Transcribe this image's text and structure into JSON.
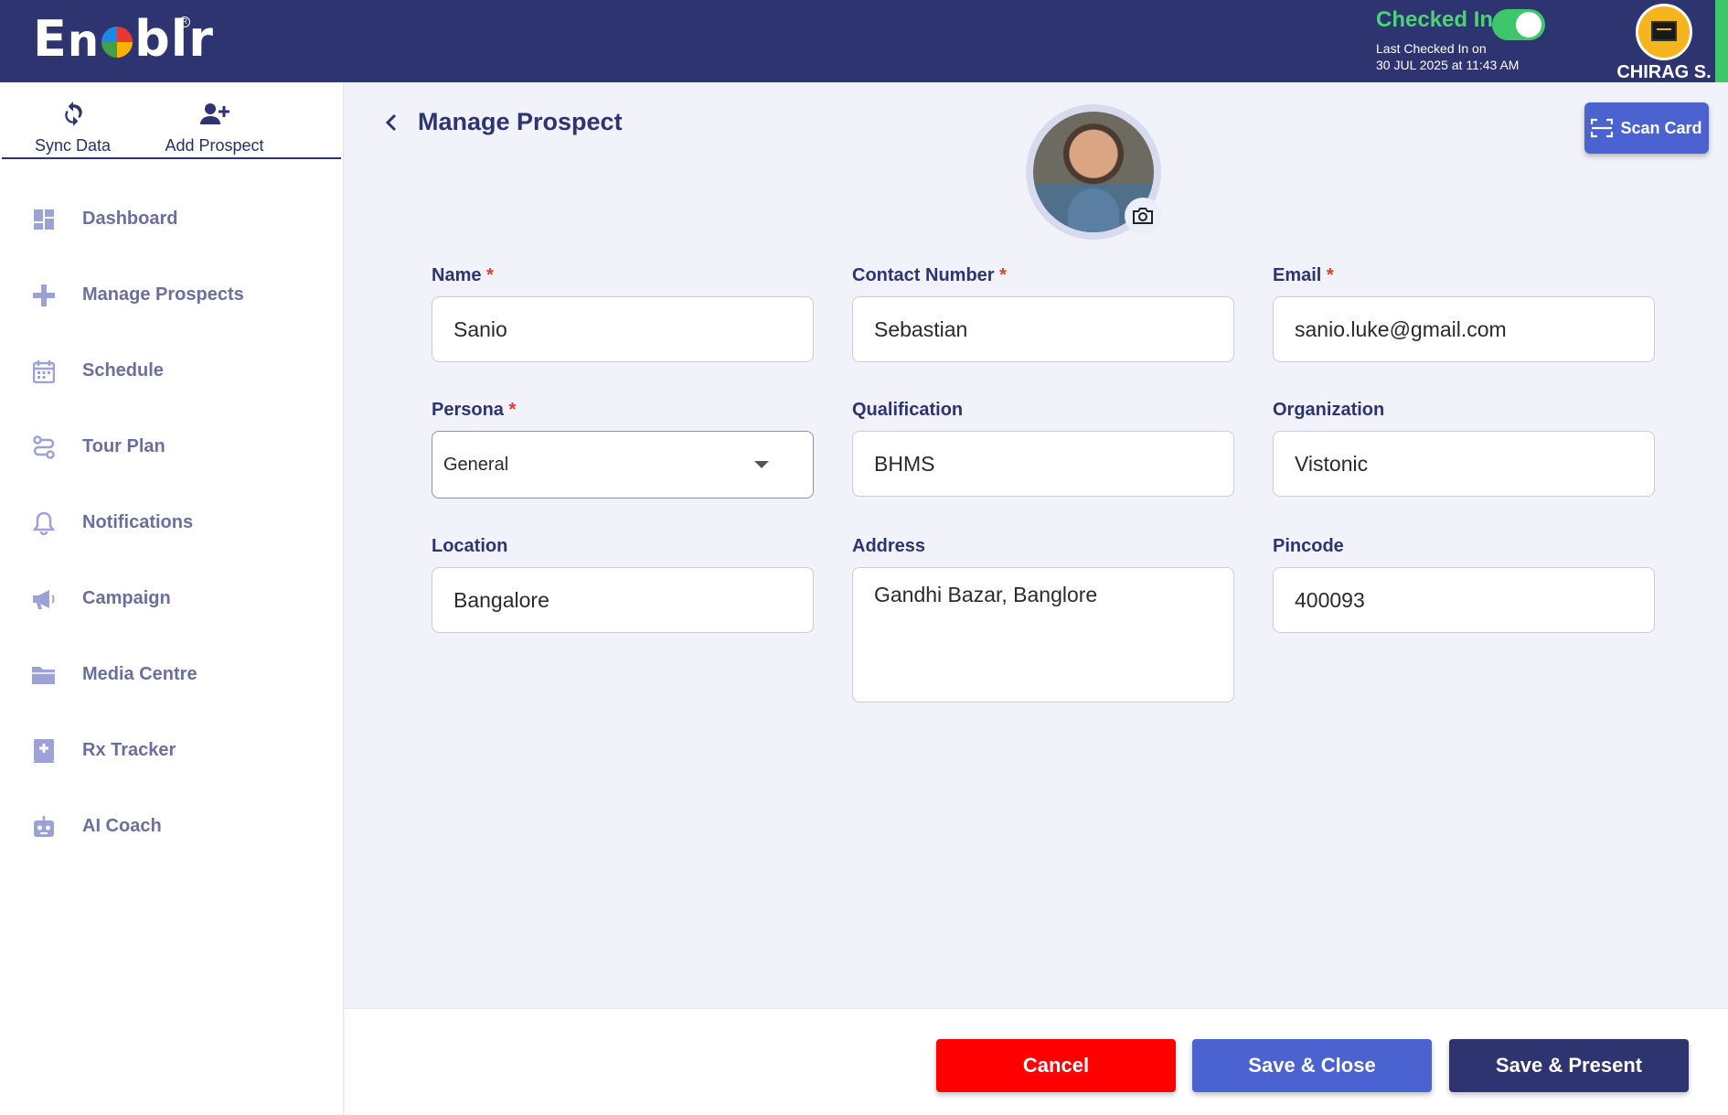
{
  "app": {
    "logo_text": "Enablr"
  },
  "topbar": {
    "checkin_label": "Checked In",
    "checkin_on": true,
    "last_checked_line1": "Last Checked In on",
    "last_checked_line2": "30 JUL 2025 at 11:43 AM",
    "user_name": "CHIRAG S."
  },
  "sidebar": {
    "quick": [
      {
        "label": "Sync Data",
        "icon": "sync-icon"
      },
      {
        "label": "Add Prospect",
        "icon": "add-user-icon"
      }
    ],
    "items": [
      {
        "label": "Dashboard",
        "icon": "dashboard-icon"
      },
      {
        "label": "Manage Prospects",
        "icon": "plus-icon"
      },
      {
        "label": "Schedule",
        "icon": "calendar-icon"
      },
      {
        "label": "Tour Plan",
        "icon": "route-icon"
      },
      {
        "label": "Notifications",
        "icon": "bell-icon"
      },
      {
        "label": "Campaign",
        "icon": "megaphone-icon"
      },
      {
        "label": "Media Centre",
        "icon": "folder-icon"
      },
      {
        "label": "Rx Tracker",
        "icon": "rx-book-icon"
      },
      {
        "label": "AI Coach",
        "icon": "robot-icon"
      }
    ]
  },
  "page": {
    "title": "Manage Prospect",
    "scan_card_label": "Scan Card"
  },
  "form": {
    "name": {
      "label": "Name",
      "required_mark": "*",
      "value": "Sanio"
    },
    "contact": {
      "label": "Contact Number",
      "required_mark": "*",
      "value": "Sebastian"
    },
    "email": {
      "label": "Email",
      "required_mark": "*",
      "value": "sanio.luke@gmail.com"
    },
    "persona": {
      "label": "Persona",
      "required_mark": "*",
      "value": "General"
    },
    "qualification": {
      "label": "Qualification",
      "value": "BHMS"
    },
    "organization": {
      "label": "Organization",
      "value": "Vistonic"
    },
    "location": {
      "label": "Location",
      "value": "Bangalore"
    },
    "address": {
      "label": "Address",
      "value": "Gandhi Bazar, Banglore"
    },
    "pincode": {
      "label": "Pincode",
      "value": "400093"
    }
  },
  "footer": {
    "cancel": "Cancel",
    "save_close": "Save & Close",
    "save_present": "Save & Present"
  },
  "colors": {
    "primary": "#2e3470",
    "accent_blue": "#4a63d0",
    "danger": "#ff0000",
    "success": "#3ec76a"
  }
}
